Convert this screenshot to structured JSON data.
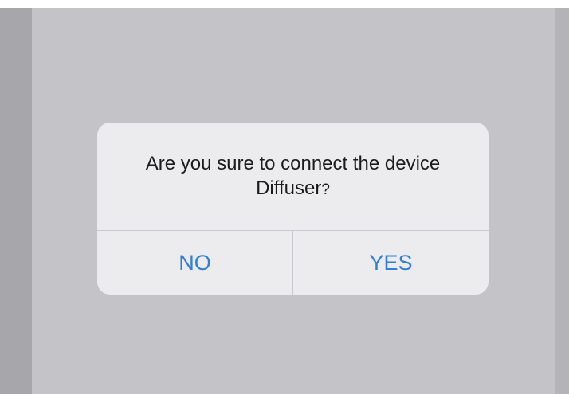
{
  "dialog": {
    "message_line1": "Are you sure to connect the device",
    "device_name": "Diffuser",
    "question_mark": "?",
    "no_label": "NO",
    "yes_label": "YES"
  },
  "colors": {
    "overlay": "#c4c4c8",
    "dialog_background": "#ececee",
    "button_text": "#2f7fd6",
    "message_text": "#1c1c1e"
  }
}
